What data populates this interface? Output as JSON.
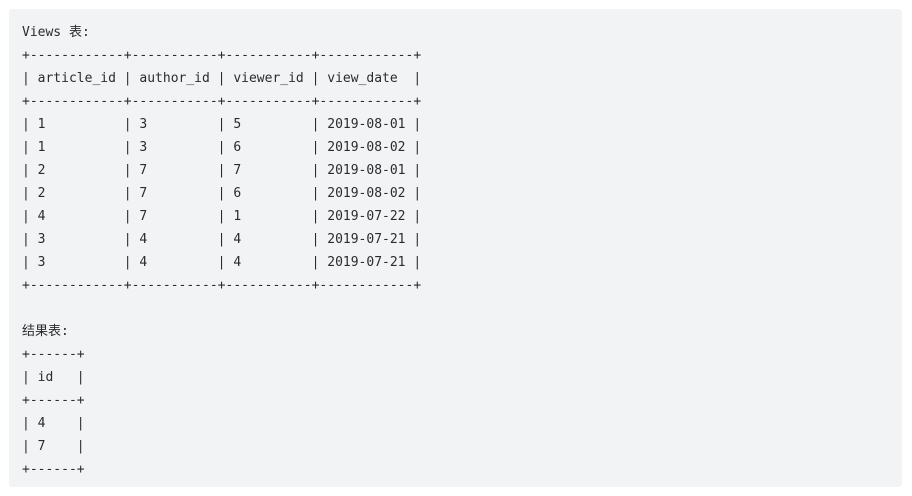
{
  "views_section": {
    "title": "Views 表:",
    "border": "+------------+-----------+-----------+------------+",
    "header_row": "| article_id | author_id | viewer_id | view_date  |",
    "rows": [
      "| 1          | 3         | 5         | 2019-08-01 |",
      "| 1          | 3         | 6         | 2019-08-02 |",
      "| 2          | 7         | 7         | 2019-08-01 |",
      "| 2          | 7         | 6         | 2019-08-02 |",
      "| 4          | 7         | 1         | 2019-07-22 |",
      "| 3          | 4         | 4         | 2019-07-21 |",
      "| 3          | 4         | 4         | 2019-07-21 |"
    ]
  },
  "result_section": {
    "title": "结果表:",
    "border": "+------+",
    "header_row": "| id   |",
    "rows": [
      "| 4    |",
      "| 7    |"
    ]
  }
}
